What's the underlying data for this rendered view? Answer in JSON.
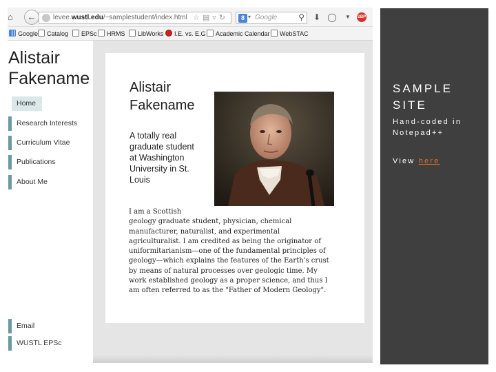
{
  "browser": {
    "url_prefix": "levee.",
    "url_domain": "wustl.edu",
    "url_path": "/~samplestudent/index.html",
    "search_placeholder": "Google",
    "search_engine_icon": "8"
  },
  "bookmarks": [
    {
      "label": "Google",
      "icon": "apps-icon"
    },
    {
      "label": "Catalog",
      "icon": "page-icon"
    },
    {
      "label": "EPSc",
      "icon": "page-icon"
    },
    {
      "label": "HRMS",
      "icon": "page-icon"
    },
    {
      "label": "LibWorks",
      "icon": "page-icon"
    },
    {
      "label": "I.E. vs. E.G",
      "icon": "red-dot-icon"
    },
    {
      "label": "Academic Calendar",
      "icon": "page-icon"
    },
    {
      "label": "WebSTAC",
      "icon": "page-icon"
    }
  ],
  "site": {
    "name_line1": "Alistair",
    "name_line2": "Fakename",
    "nav": [
      "Home",
      "Research Interests",
      "Curriculum Vitae",
      "Publications",
      "About Me"
    ],
    "footer_links": [
      "Email",
      "WUSTL EPSc"
    ]
  },
  "card": {
    "title_line1": "Alistair",
    "title_line2": "Fakename",
    "subtitle_lines": [
      "A totally real",
      "graduate student",
      "at Washington",
      "University in St.",
      "Louis"
    ],
    "bio_lines": [
      "I am a Scottish",
      "geology graduate student, physician, chemical",
      "manufacturer, naturalist, and experimental",
      "agriculturalist. I am credited as being the originator of",
      "uniformitarianism—one of the fundamental principles of",
      "geology—which explains the features of the Earth's crust",
      "by means of natural processes over geologic time. My",
      "work established geology as a proper science, and thus I",
      "am often referred to as the \"Father of Modern Geology\"."
    ]
  },
  "panel": {
    "title_line1": "SAMPLE",
    "title_line2": "SITE",
    "desc_line1": "Hand-coded in",
    "desc_line2": "Notepad++",
    "view_prefix": "View ",
    "view_link": "here"
  },
  "colors": {
    "panel_bg": "#3f3f3f",
    "link": "#e26f2a",
    "nav_accent": "#6c9aa2",
    "home_highlight": "#dbe8ea"
  }
}
